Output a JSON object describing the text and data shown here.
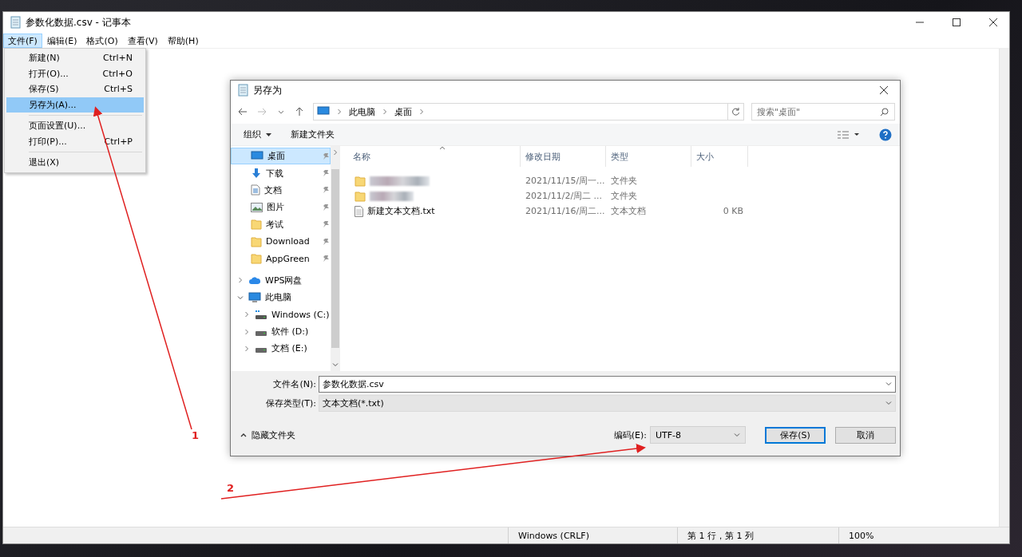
{
  "notepad": {
    "title": "参数化数据.csv - 记事本",
    "menubar": [
      {
        "label": "文件(F)",
        "selected": true
      },
      {
        "label": "编辑(E)",
        "selected": false
      },
      {
        "label": "格式(O)",
        "selected": false
      },
      {
        "label": "查看(V)",
        "selected": false
      },
      {
        "label": "帮助(H)",
        "selected": false
      }
    ],
    "file_menu": [
      {
        "kind": "item",
        "label": "新建(N)",
        "shortcut": "Ctrl+N",
        "selected": false
      },
      {
        "kind": "item",
        "label": "打开(O)...",
        "shortcut": "Ctrl+O",
        "selected": false
      },
      {
        "kind": "item",
        "label": "保存(S)",
        "shortcut": "Ctrl+S",
        "selected": false
      },
      {
        "kind": "item",
        "label": "另存为(A)...",
        "selected": true
      },
      {
        "kind": "separator"
      },
      {
        "kind": "item",
        "label": "页面设置(U)...",
        "selected": false
      },
      {
        "kind": "item",
        "label": "打印(P)...",
        "shortcut": "Ctrl+P",
        "selected": false
      },
      {
        "kind": "separator"
      },
      {
        "kind": "item",
        "label": "退出(X)",
        "selected": false
      }
    ],
    "status_bar": {
      "line_ending": "Windows (CRLF)",
      "position": "第 1 行，第 1 列",
      "zoom": "100%"
    }
  },
  "save_dialog": {
    "title": "另存为",
    "breadcrumb": [
      "此电脑",
      "桌面"
    ],
    "search": {
      "placeholder": "搜索\"桌面\""
    },
    "toolbar": {
      "organize": "组织",
      "new_folder": "新建文件夹"
    },
    "quick_access": [
      {
        "label": "桌面",
        "kind": "desktop",
        "pinned": true,
        "selected": true
      },
      {
        "label": "下载",
        "kind": "download",
        "pinned": true,
        "selected": false
      },
      {
        "label": "文档",
        "kind": "document",
        "pinned": true,
        "selected": false
      },
      {
        "label": "图片",
        "kind": "picture",
        "pinned": true,
        "selected": false
      },
      {
        "label": "考试",
        "kind": "folder",
        "pinned": true,
        "selected": false
      },
      {
        "label": "Download",
        "kind": "folder",
        "pinned": true,
        "selected": false
      },
      {
        "label": "AppGreen",
        "kind": "folder",
        "pinned": true,
        "selected": false
      }
    ],
    "locations": [
      {
        "label": "WPS网盘",
        "kind": "cloud",
        "expanded": false
      },
      {
        "label": "此电脑",
        "kind": "pc",
        "expanded": true,
        "children": [
          {
            "label": "Windows (C:)",
            "kind": "system-drive",
            "expanded": false
          },
          {
            "label": "软件 (D:)",
            "kind": "drive",
            "expanded": false
          },
          {
            "label": "文档 (E:)",
            "kind": "drive",
            "expanded": false
          }
        ]
      }
    ],
    "columns": [
      "名称",
      "修改日期",
      "类型",
      "大小"
    ],
    "files": [
      {
        "kind": "folder",
        "date": "2021/11/15/周一...",
        "type": "文件夹"
      },
      {
        "kind": "folder",
        "date": "2021/11/2/周二 ...",
        "type": "文件夹"
      },
      {
        "kind": "file",
        "name": "新建文本文档.txt",
        "date": "2021/11/16/周二...",
        "type": "文本文档",
        "size": "0 KB"
      }
    ],
    "file_name": {
      "label": "文件名(N):",
      "value": "参数化数据.csv"
    },
    "save_type": {
      "label": "保存类型(T):",
      "value": "文本文档(*.txt)"
    },
    "hide_folders": "隐藏文件夹",
    "encoding": {
      "label": "编码(E):",
      "value": "UTF-8"
    },
    "buttons": [
      {
        "label": "保存(S)",
        "kind": "primary"
      },
      {
        "label": "取消",
        "kind": "secondary"
      }
    ]
  },
  "annotations": [
    {
      "label": "1"
    },
    {
      "label": "2"
    }
  ]
}
